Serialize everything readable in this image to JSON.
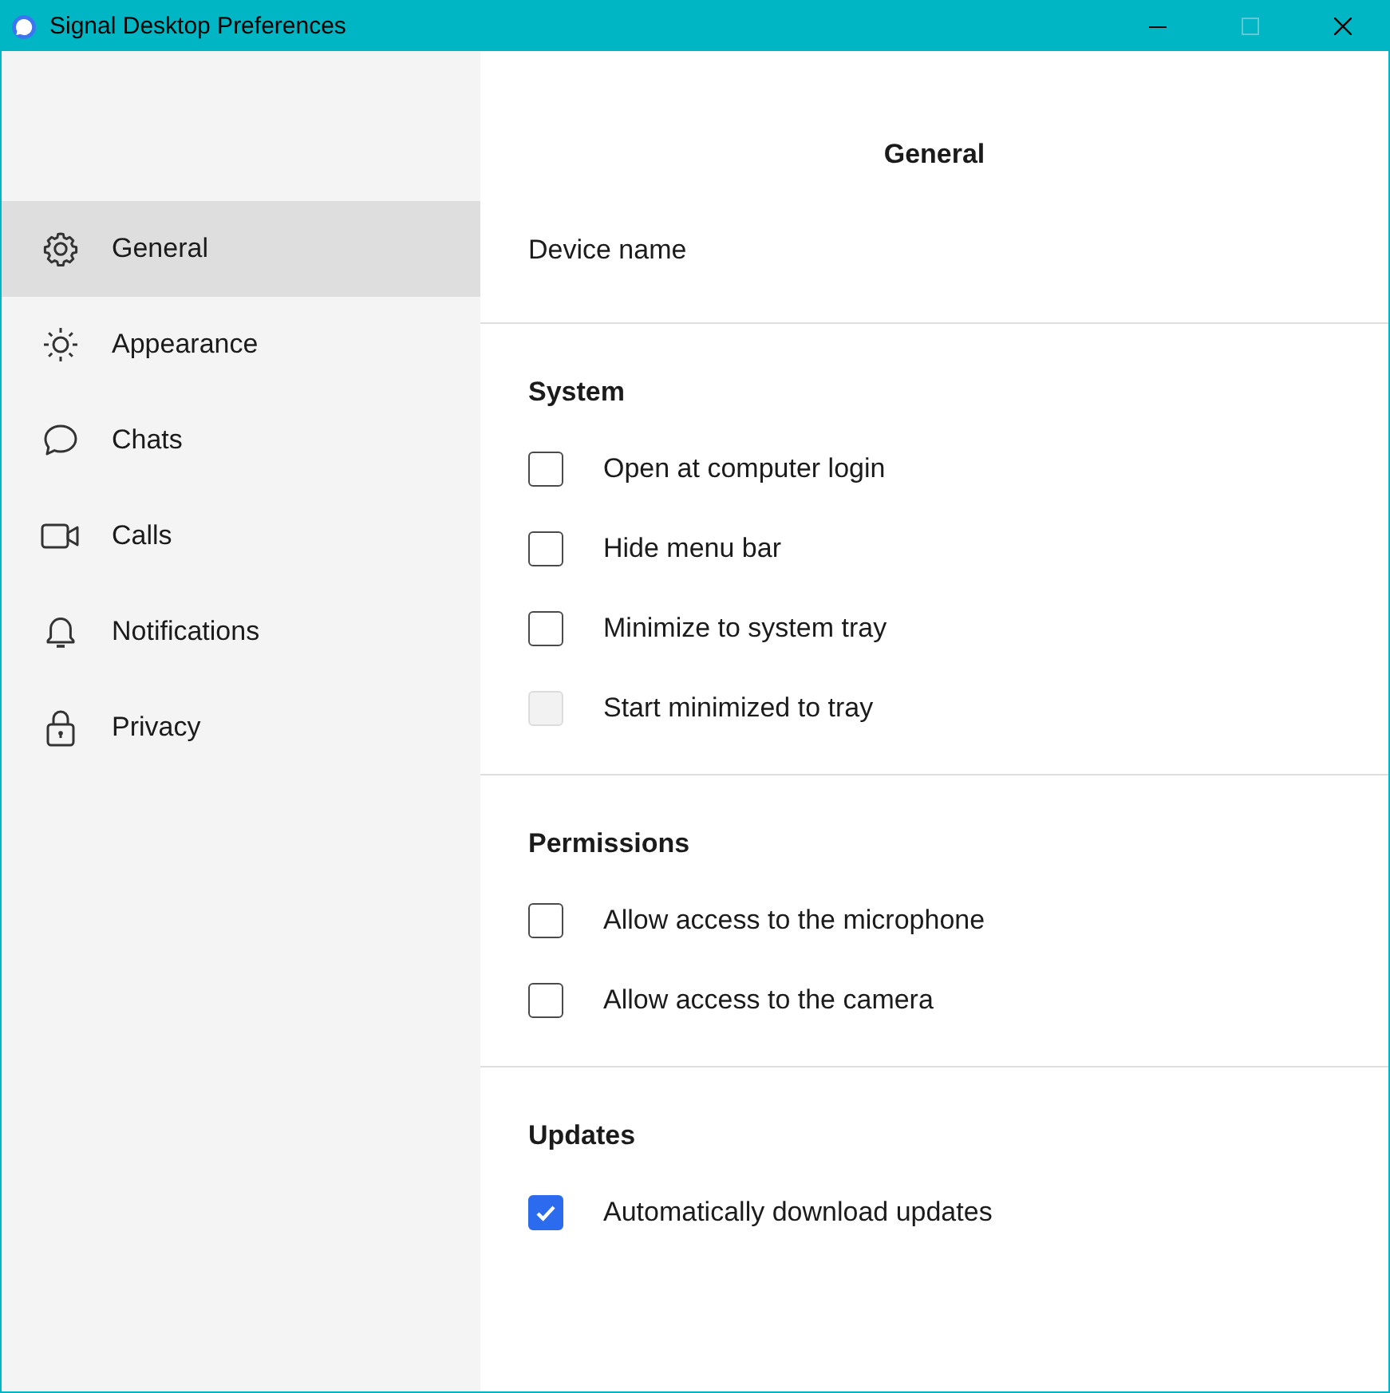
{
  "window": {
    "title": "Signal Desktop Preferences",
    "controls": [
      {
        "kind": "minimize",
        "disabled": false
      },
      {
        "kind": "maximize",
        "disabled": true
      },
      {
        "kind": "close",
        "disabled": false
      }
    ]
  },
  "sidebar": {
    "items": [
      {
        "label": "General",
        "selected": true
      },
      {
        "label": "Appearance",
        "selected": false
      },
      {
        "label": "Chats",
        "selected": false
      },
      {
        "label": "Calls",
        "selected": false
      },
      {
        "label": "Notifications",
        "selected": false
      },
      {
        "label": "Privacy",
        "selected": false
      }
    ]
  },
  "page": {
    "title": "General",
    "device_label": "Device name",
    "sections": [
      {
        "title": "System",
        "options": [
          {
            "label": "Open at computer login",
            "checked": false,
            "disabled": false
          },
          {
            "label": "Hide menu bar",
            "checked": false,
            "disabled": false
          },
          {
            "label": "Minimize to system tray",
            "checked": false,
            "disabled": false
          },
          {
            "label": "Start minimized to tray",
            "checked": false,
            "disabled": true
          }
        ]
      },
      {
        "title": "Permissions",
        "options": [
          {
            "label": "Allow access to the microphone",
            "checked": false,
            "disabled": false
          },
          {
            "label": "Allow access to the camera",
            "checked": false,
            "disabled": false
          }
        ]
      },
      {
        "title": "Updates",
        "options": [
          {
            "label": "Automatically download updates",
            "checked": true,
            "disabled": false
          }
        ]
      }
    ]
  }
}
